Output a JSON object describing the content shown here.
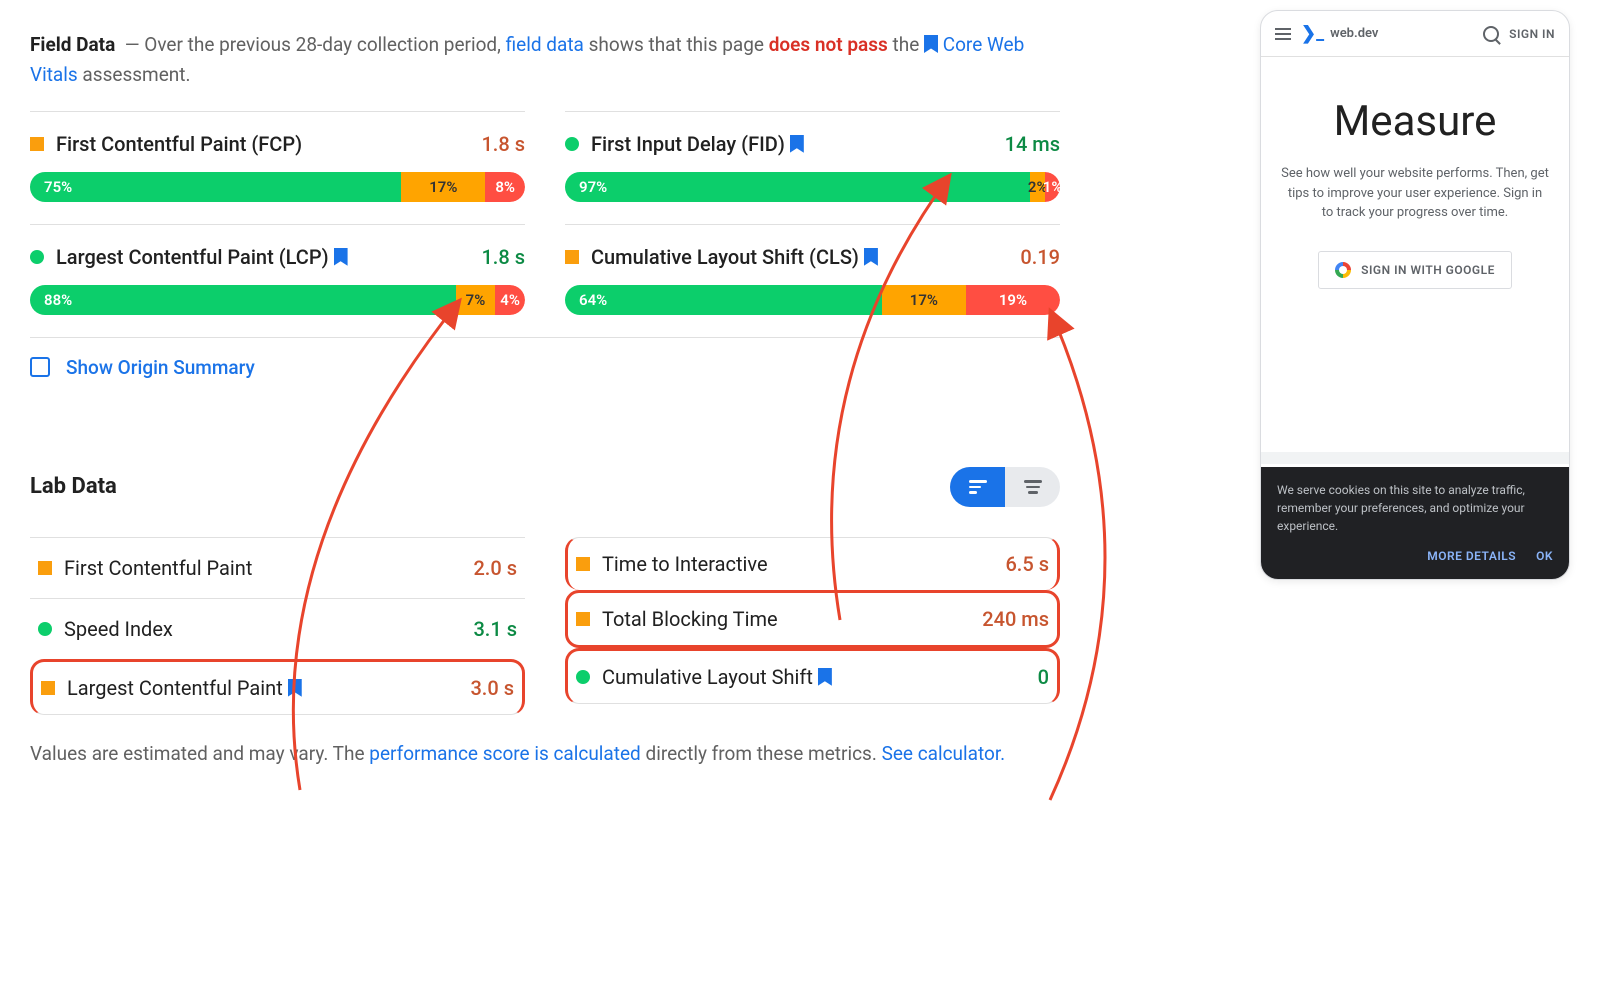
{
  "fieldHeader": {
    "title": "Field Data",
    "text1": "— Over the previous 28-day collection period,",
    "linkFieldData": "field data",
    "text2": "shows that this page",
    "fail": "does not pass",
    "text3": "the",
    "linkCWV": "Core Web Vitals",
    "text4": "assessment."
  },
  "metrics": {
    "fcp": {
      "name": "First Contentful Paint (FCP)",
      "value": "1.8 s",
      "g": "75%",
      "o": "17%",
      "r": "8%"
    },
    "fid": {
      "name": "First Input Delay (FID)",
      "value": "14 ms",
      "g": "97%",
      "o": "2%",
      "r": "1%"
    },
    "lcp": {
      "name": "Largest Contentful Paint (LCP)",
      "value": "1.8 s",
      "g": "88%",
      "o": "7%",
      "r": "4%"
    },
    "cls": {
      "name": "Cumulative Layout Shift (CLS)",
      "value": "0.19",
      "g": "64%",
      "o": "17%",
      "r": "19%"
    }
  },
  "showOrigin": "Show Origin Summary",
  "labTitle": "Lab Data",
  "lab": {
    "fcp": {
      "name": "First Contentful Paint",
      "value": "2.0 s"
    },
    "si": {
      "name": "Speed Index",
      "value": "3.1 s"
    },
    "lcp": {
      "name": "Largest Contentful Paint",
      "value": "3.0 s"
    },
    "tti": {
      "name": "Time to Interactive",
      "value": "6.5 s"
    },
    "tbt": {
      "name": "Total Blocking Time",
      "value": "240 ms"
    },
    "cls": {
      "name": "Cumulative Layout Shift",
      "value": "0"
    }
  },
  "footer": {
    "t1": "Values are estimated and may vary. The",
    "link1": "performance score is calculated",
    "t2": "directly from these metrics.",
    "link2": "See calculator."
  },
  "device": {
    "brand": "web.dev",
    "signin": "SIGN IN",
    "heading": "Measure",
    "para": "See how well your website performs. Then, get tips to improve your user experience. Sign in to track your progress over time.",
    "googleBtn": "SIGN IN WITH GOOGLE",
    "cookie": "We serve cookies on this site to analyze traffic, remember your preferences, and optimize your experience.",
    "more": "MORE DETAILS",
    "ok": "OK"
  }
}
